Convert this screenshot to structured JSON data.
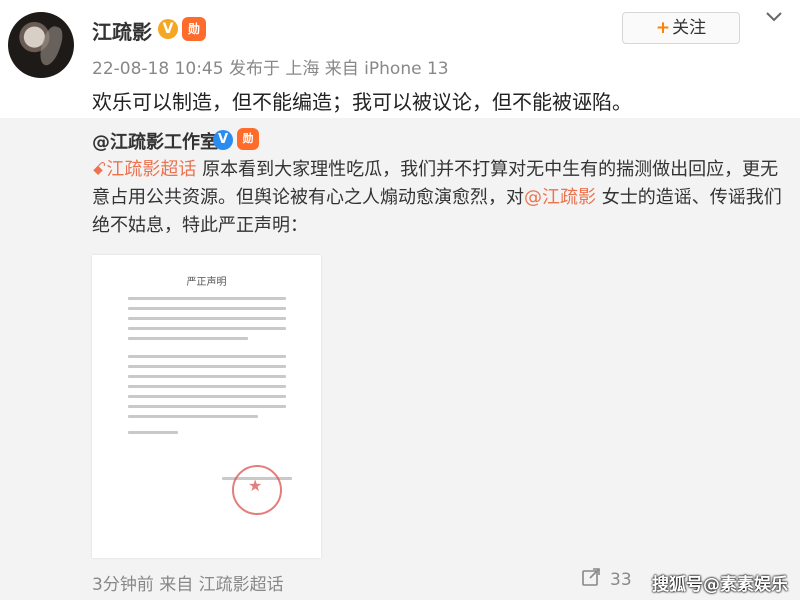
{
  "post": {
    "username": "江疏影",
    "verified_badge": "V",
    "medal_badge": "勋",
    "follow_plus": "+",
    "follow_label": "关注",
    "meta": "22-08-18 10:45 发布于 上海 来自 iPhone 13",
    "text": "欢乐可以制造，但不能编造；我可以被议论，但不能被诬陷。"
  },
  "retweet": {
    "author": "@江疏影工作室",
    "verified_badge": "V",
    "medal_badge": "勋",
    "topic_icon": "ꗃ",
    "topic_link": "江疏影超话",
    "text_part1": " 原本看到大家理性吃瓜，我们并不打算对无中生有的揣测做出回应，更无意占用公共资源。但舆论被有心之人煽动愈演愈烈，对",
    "mention_link": "@江疏影",
    "text_part2": " 女士的造谣、传谣我们绝不姑息，特此严正声明："
  },
  "document": {
    "title": "严正声明"
  },
  "footer": {
    "time_source": "3分钟前 来自 江疏影超话",
    "share_count": "33",
    "watermark": "搜狐号@素素娱乐"
  },
  "icons": {
    "share": "share-icon",
    "chevron": "chevron-down-icon"
  },
  "colors": {
    "link": "#eb7350",
    "retweet_bg": "#f3f3f3",
    "follow_plus": "#ff8200"
  }
}
